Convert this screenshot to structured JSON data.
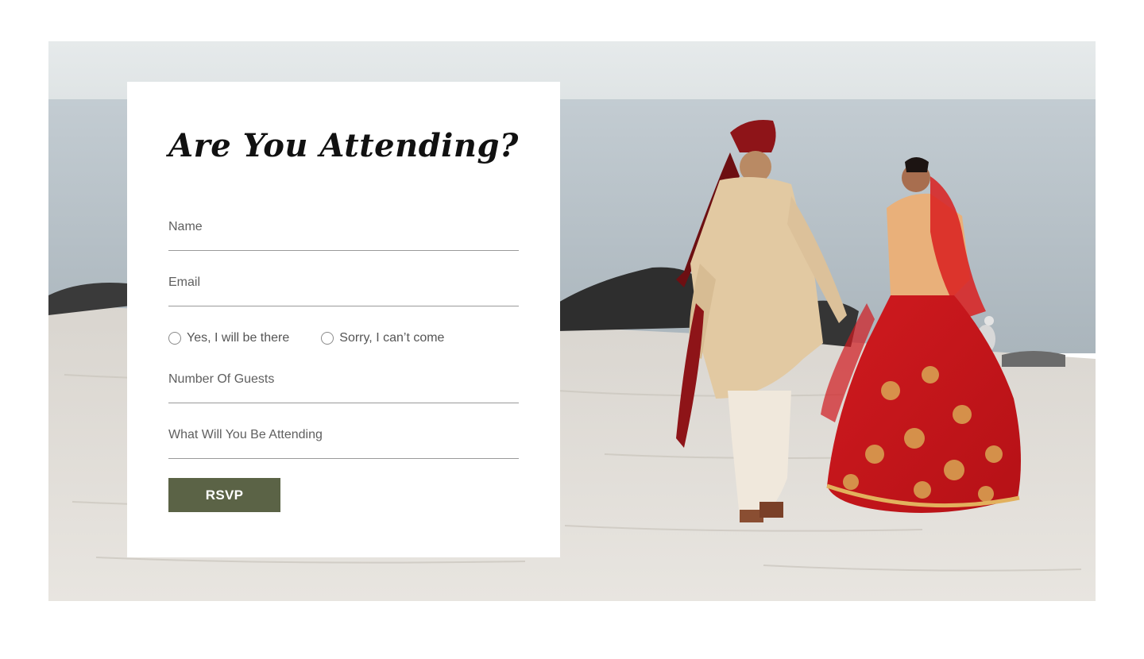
{
  "rsvp_form": {
    "title": "Are You Attending?",
    "fields": {
      "name_placeholder": "Name",
      "email_placeholder": "Email",
      "guests_placeholder": "Number Of Guests",
      "attending_placeholder": "What Will You Be Attending"
    },
    "radio_options": [
      {
        "label": "Yes, I will be there",
        "selected": false
      },
      {
        "label": "Sorry, I can’t come",
        "selected": false
      }
    ],
    "submit_label": "RSVP"
  },
  "colors": {
    "button": "#5b6346",
    "accent_red": "#c8161b",
    "sand": "#e3dfd8",
    "sea": "#b9c3c9"
  }
}
